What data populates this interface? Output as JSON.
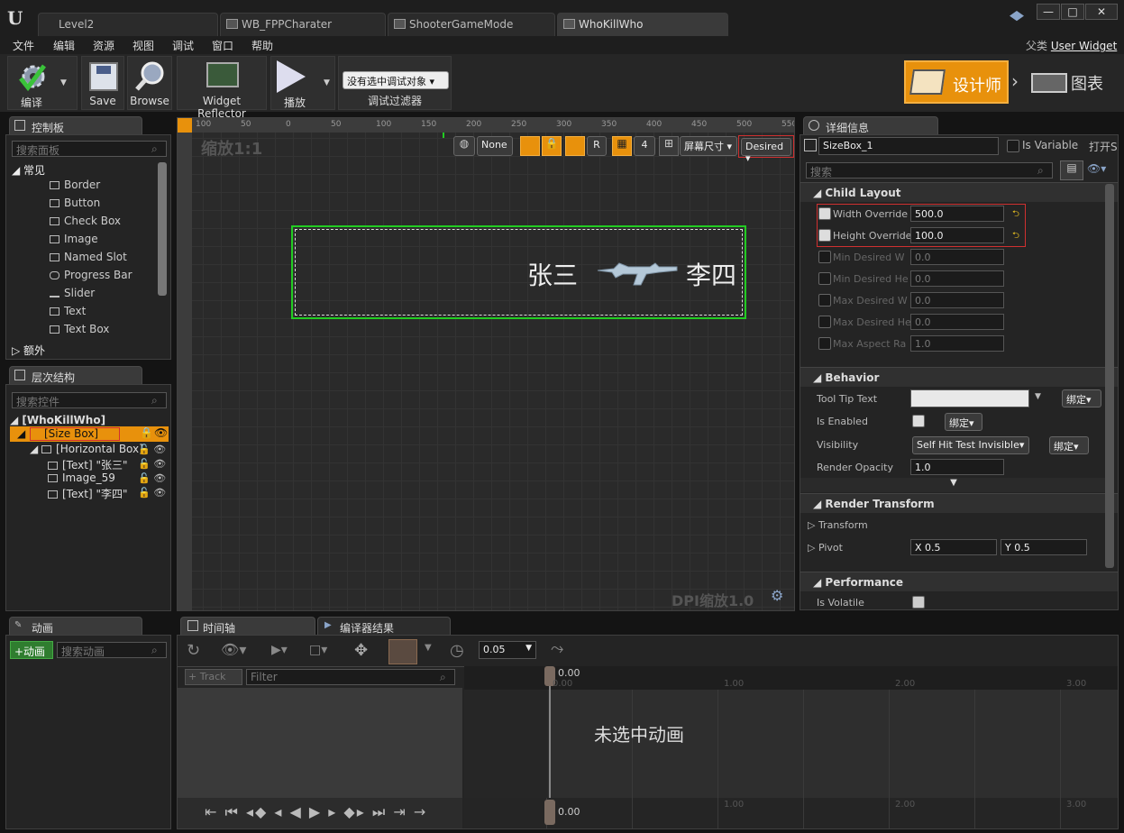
{
  "window": {
    "tabs": [
      "Level2",
      "WB_FPPCharater",
      "ShooterGameMode",
      "WhoKillWho"
    ],
    "buttons": [
      "—",
      "□",
      "✕"
    ]
  },
  "menu": [
    "文件",
    "编辑",
    "资源",
    "视图",
    "调试",
    "窗口",
    "帮助"
  ],
  "parent_class": {
    "label": "父类",
    "value": "User Widget"
  },
  "toolbar": {
    "compile": "编译",
    "save": "Save",
    "browse": "Browse",
    "reflector": "Widget Reflector",
    "play": "播放",
    "debug_select": "没有选中调试对象",
    "debug_filter": "调试过滤器",
    "designer": "设计师",
    "graph": "图表"
  },
  "palette": {
    "title": "控制板",
    "search_placeholder": "搜索面板",
    "category_common": "常见",
    "category_extra": "额外",
    "items": [
      "Border",
      "Button",
      "Check Box",
      "Image",
      "Named Slot",
      "Progress Bar",
      "Slider",
      "Text",
      "Text Box"
    ]
  },
  "hierarchy": {
    "title": "层次结构",
    "search_placeholder": "搜索控件",
    "root": "[WhoKillWho]",
    "size_box": "[Size Box]",
    "horizontal_box": "[Horizontal Box]",
    "text1": "[Text] \"张三\"",
    "image": "Image_59",
    "text2": "[Text] \"李四\""
  },
  "canvas": {
    "zoom": "缩放1:1",
    "dpi": "DPI缩放1.0",
    "none_btn": "None",
    "r_btn": "R",
    "grid_num": "4",
    "screen_size": "屏幕尺寸",
    "desired": "Desired",
    "ruler_ticks": [
      "100",
      "50",
      "0",
      "50",
      "100",
      "150",
      "200",
      "250",
      "300",
      "350",
      "400",
      "450",
      "500",
      "550"
    ],
    "name_left": "张三",
    "name_right": "李四"
  },
  "details": {
    "title": "详细信息",
    "name": "SizeBox_1",
    "is_variable": "Is Variable",
    "open": "打开S",
    "search_placeholder": "搜索",
    "child_layout": "Child Layout",
    "width_override": "Width Override",
    "width_value": "500.0",
    "height_override": "Height Override",
    "height_value": "100.0",
    "min_desired_w": "Min Desired W",
    "min_desired_h": "Min Desired He",
    "max_desired_w": "Max Desired W",
    "max_desired_h": "Max Desired He",
    "max_aspect": "Max Aspect Ra",
    "v0": "0.0",
    "v1": "1.0",
    "behavior": "Behavior",
    "tooltip": "Tool Tip Text",
    "bind": "绑定",
    "is_enabled": "Is Enabled",
    "visibility": "Visibility",
    "visibility_value": "Self Hit Test Invisible",
    "render_opacity": "Render Opacity",
    "opacity_value": "1.0",
    "render_transform": "Render Transform",
    "transform": "Transform",
    "pivot": "Pivot",
    "pivot_x": "X  0.5",
    "pivot_y": "Y  0.5",
    "performance": "Performance",
    "is_volatile": "Is Volatile"
  },
  "animation": {
    "title": "动画",
    "add": "+动画",
    "search_placeholder": "搜索动画"
  },
  "timeline": {
    "tab1": "时间轴",
    "tab2": "编译器结果",
    "speed": "0.05",
    "track": "+ Track",
    "filter": "Filter",
    "t0": "0.00",
    "t1": "1.00",
    "t2": "2.00",
    "t3": "3.00",
    "no_anim": "未选中动画"
  },
  "colors": {
    "accent": "#e8910c",
    "selection_green": "#22cc22",
    "highlight_red": "#d03030"
  }
}
